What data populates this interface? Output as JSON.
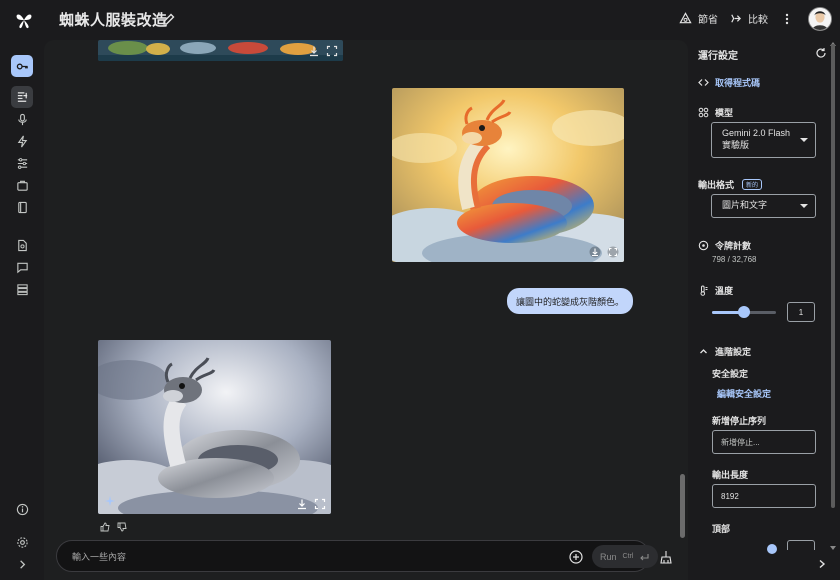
{
  "app": {
    "title": "蜘蛛人服裝改造"
  },
  "topbar": {
    "save_label": "節省",
    "compare_label": "比較"
  },
  "chat": {
    "user_message": "讓圖中的蛇變成灰階顏色。",
    "input_placeholder": "輸入一些內容",
    "run_label": "Run",
    "run_shortcut": "Ctrl"
  },
  "settings": {
    "title": "運行設定",
    "get_code_label": "取得程式碼",
    "model_label": "模型",
    "model_value": "Gemini 2.0 Flash 實驗版",
    "output_format_label": "輸出格式",
    "output_format_badge": "新的",
    "output_format_value": "圖片和文字",
    "token_count_label": "令牌計數",
    "token_count_value": "798 / 32,768",
    "temperature_label": "溫度",
    "temperature_value": "1",
    "temperature_fraction": 0.5,
    "advanced_label": "進階設定",
    "safety_label": "安全設定",
    "edit_safety_label": "編輯安全設定",
    "stop_sequence_label": "新增停止序列",
    "stop_sequence_placeholder": "新增停止...",
    "output_length_label": "輸出長度",
    "output_length_value": "8192",
    "top_p_label": "頂部"
  },
  "colors": {
    "accent": "#a8c7fa",
    "user_bubble": "#c2d6fb",
    "background": "#1b1b1d",
    "chat_bg": "#1e1f20"
  },
  "icons": [
    "logo-icon",
    "edit-icon",
    "save-icon",
    "compare-icon",
    "more-icon",
    "key-icon",
    "chat-icon",
    "mic-icon",
    "bolt-icon",
    "tune-icon",
    "bag-icon",
    "book-icon",
    "doc-search-icon",
    "feedback-icon",
    "storage-icon",
    "info-icon",
    "settings-icon",
    "expand-icon",
    "download-icon",
    "fullscreen-icon",
    "thumb-up-icon",
    "thumb-down-icon",
    "add-icon",
    "broom-icon",
    "refresh-icon",
    "code-icon",
    "model-icon",
    "token-icon",
    "thermometer-icon",
    "chevron-up-icon"
  ]
}
